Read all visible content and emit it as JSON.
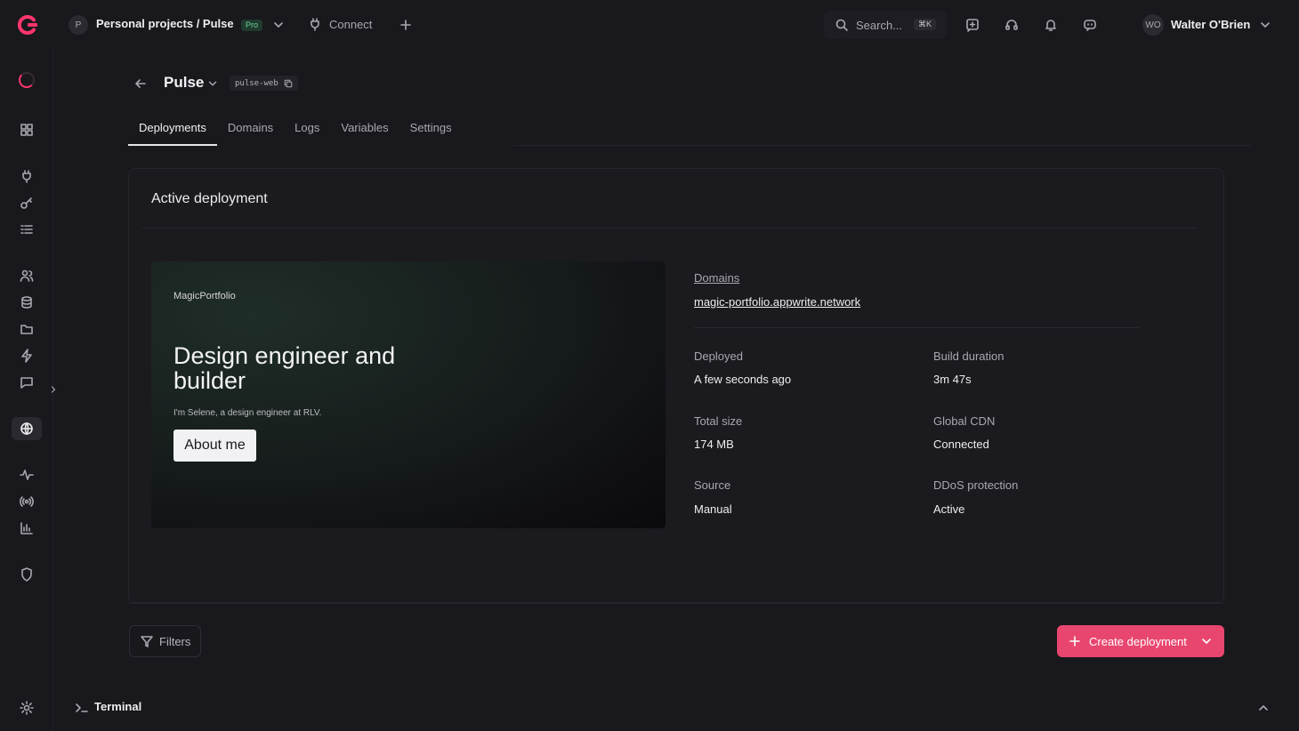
{
  "brand": {
    "accent": "#fd366e",
    "button_color": "#e8466f"
  },
  "topbar": {
    "project_avatar": "P",
    "project_path": "Personal projects / Pulse",
    "plan_badge": "Pro",
    "connect_label": "Connect",
    "search_placeholder": "Search...",
    "search_shortcut": "⌘K",
    "user_initials": "WO",
    "user_name": "Walter O'Brien",
    "icons": [
      "feedback-icon",
      "support-icon",
      "notifications-icon",
      "assistant-icon"
    ]
  },
  "sidebar": {
    "items": [
      "overview",
      "connect",
      "keys",
      "databases",
      "auth",
      "storage",
      "folders",
      "functions",
      "messaging",
      "sites",
      "monitoring",
      "realtime",
      "usage",
      "security",
      "settings"
    ],
    "active": "sites"
  },
  "header": {
    "title": "Pulse",
    "slug": "pulse-web"
  },
  "tabs": [
    {
      "label": "Deployments",
      "active": true
    },
    {
      "label": "Domains",
      "active": false
    },
    {
      "label": "Logs",
      "active": false
    },
    {
      "label": "Variables",
      "active": false
    },
    {
      "label": "Settings",
      "active": false
    }
  ],
  "active_deployment": {
    "title": "Active deployment",
    "preview": {
      "brand": "MagicPortfolio",
      "headline": "Design engineer and builder",
      "subtitle": "I'm Selene, a design engineer at RLV.",
      "button": "About me"
    },
    "domains_label": "Domains",
    "domain": "magic-portfolio.appwrite.network",
    "meta": {
      "deployed_label": "Deployed",
      "deployed_value": "A few seconds ago",
      "build_label": "Build duration",
      "build_value": "3m 47s",
      "size_label": "Total size",
      "size_value": "174 MB",
      "cdn_label": "Global CDN",
      "cdn_value": "Connected",
      "source_label": "Source",
      "source_value": "Manual",
      "ddos_label": "DDoS protection",
      "ddos_value": "Active"
    }
  },
  "actions": {
    "filters_label": "Filters",
    "create_label": "Create deployment"
  },
  "terminal": {
    "label": "Terminal"
  }
}
